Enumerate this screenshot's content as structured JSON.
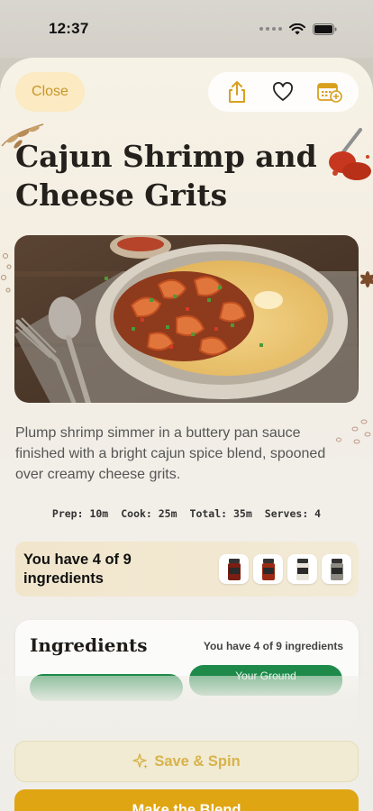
{
  "status_bar": {
    "time": "12:37"
  },
  "header": {
    "close_label": "Close",
    "actions": [
      "share-icon",
      "heart-icon",
      "calendar-add-icon"
    ]
  },
  "recipe": {
    "title": "Cajun Shrimp and Cheese Grits",
    "description": "Plump shrimp simmer in a buttery pan sauce finished with a bright cajun spice blend, spooned over creamy cheese grits.",
    "stats": {
      "prep": "Prep: 10m",
      "cook": "Cook: 25m",
      "total": "Total: 35m",
      "serves": "Serves: 4"
    }
  },
  "have_banner": {
    "text": "You have 4 of 9 ingredients",
    "jar_count": 4
  },
  "ingredients": {
    "title": "Ingredients",
    "count_text": "You have 4 of 9 ingredients",
    "chip_partial_label": "Your Ground"
  },
  "actions": {
    "save_spin_label": "Save & Spin",
    "make_blend_label": "Make the Blend"
  },
  "colors": {
    "accent": "#dfa512",
    "close_bg": "#fbeac2",
    "close_text": "#c9962a",
    "chip_green": "#1e8a4a"
  }
}
